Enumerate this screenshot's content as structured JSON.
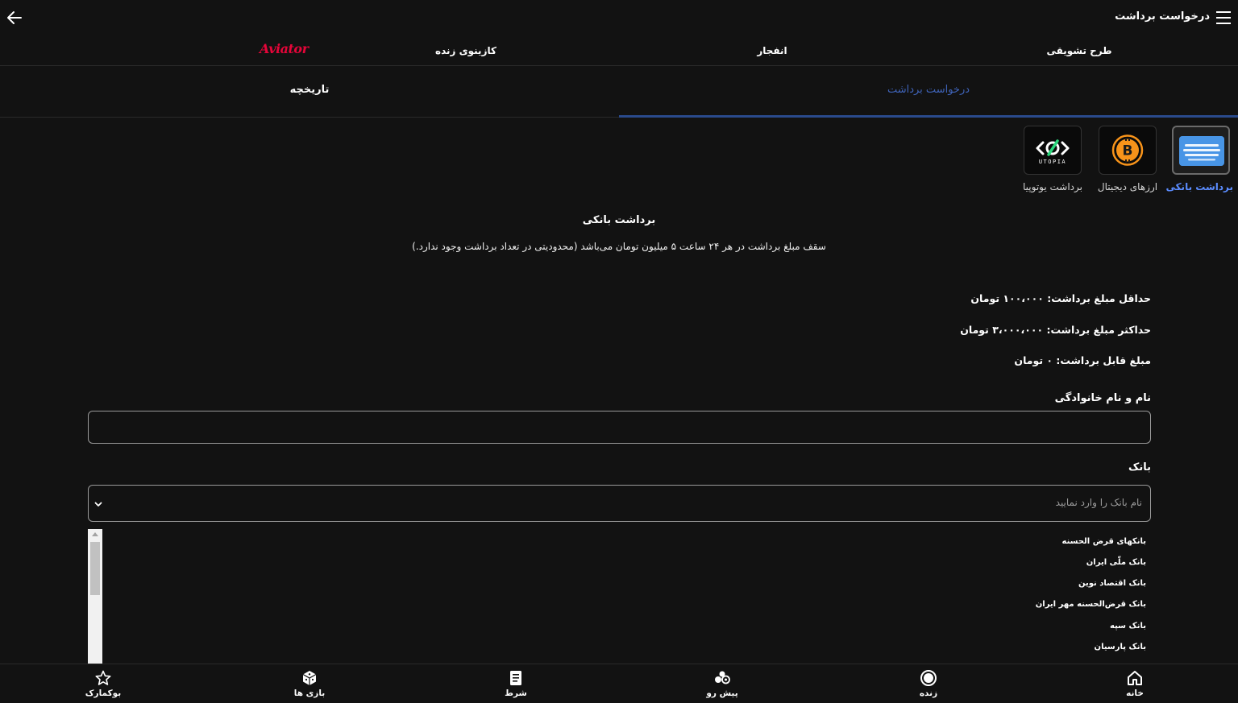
{
  "header": {
    "title": "درخواست برداشت"
  },
  "category_nav": {
    "items": [
      {
        "label": "طرح تشویقی"
      },
      {
        "label": "انفجار"
      },
      {
        "label": "کازینوی زنده"
      },
      {
        "label": "Aviator"
      }
    ]
  },
  "tabs": {
    "request": "درخواست برداشت",
    "history": "تاریخچه"
  },
  "methods": [
    {
      "label": "برداشت بانکی",
      "icon": "bank-card-icon",
      "active": true
    },
    {
      "label": "ارزهای دیجیتال",
      "icon": "bitcoin-icon",
      "active": false
    },
    {
      "label": "برداشت یوتوپیا",
      "icon": "utopia-logo-icon",
      "active": false
    }
  ],
  "utopia_logo_text": "UTOPIA",
  "section": {
    "title": "برداشت بانکی",
    "subtitle": "سقف مبلغ برداشت در هر ۲۴ ساعت ۵ میلیون تومان می‌باشد (محدودیتی در تعداد برداشت وجود ندارد.)"
  },
  "limits": {
    "min": "حداقل مبلغ برداشت: ۱۰۰،۰۰۰ تومان",
    "max": "حداکثر مبلغ برداشت: ۳،۰۰۰،۰۰۰ تومان",
    "available": "مبلغ قابل برداشت: ۰ تومان"
  },
  "form": {
    "name_label": "نام و نام خانوادگی",
    "name_value": "",
    "bank_label": "بانک",
    "bank_placeholder": "نام بانک را وارد نمایید"
  },
  "bank_options": [
    "بانکهای قرض الحسنه",
    "بانک ملّی ایران",
    "بانک اقتصاد نوین",
    "بانک قرض‌الحسنه مهر ایران",
    "بانک سپه",
    "بانک پارسیان"
  ],
  "bottom_nav": {
    "home": "خانه",
    "live": "زنده",
    "prematch": "پیش رو",
    "bet": "شرط",
    "games": "بازی ها",
    "bookmark": "بوکمارک"
  },
  "colors": {
    "background": "#121212",
    "active_tab": "#3f63b8",
    "active_method": "#5b8cff",
    "aviator_red": "#e50539",
    "bitcoin_orange": "#f7931a"
  }
}
